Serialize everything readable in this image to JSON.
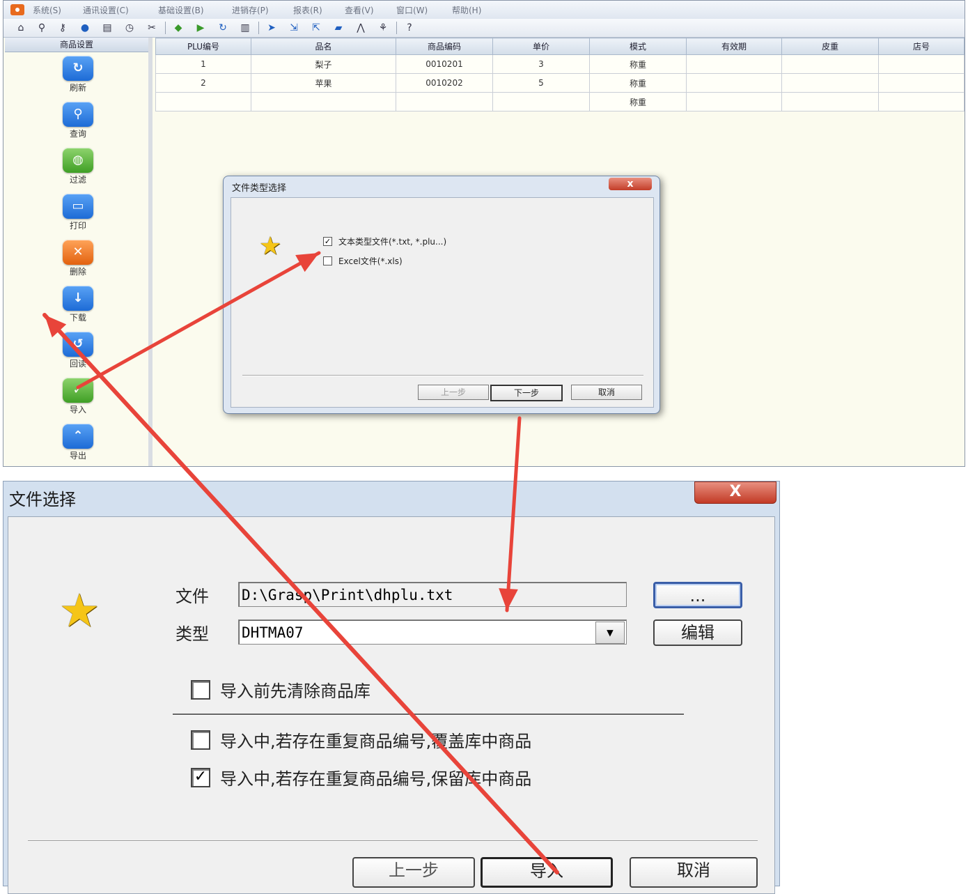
{
  "main_window": {
    "menu": [
      "系统(S)",
      "通讯设置(C)",
      "基础设置(B)",
      "进销存(P)",
      "报表(R)",
      "查看(V)",
      "窗口(W)",
      "帮助(H)"
    ],
    "toolbar_icons": [
      "home-icon",
      "pin-icon",
      "key-icon",
      "globe-icon",
      "document-icon",
      "clock-icon",
      "tools-icon",
      "diamond-icon",
      "arrow-right-icon",
      "refresh-icon",
      "book-icon",
      "send-icon",
      "export-icon",
      "import-icon",
      "folder-icon",
      "chart-icon",
      "tree-icon",
      "help-icon"
    ],
    "left_panel": {
      "header": "商品设置",
      "buttons": [
        {
          "label": "刷新",
          "icon": "refresh-icon",
          "color": "#2f7fe0"
        },
        {
          "label": "查询",
          "icon": "search-icon",
          "color": "#2f7fe0"
        },
        {
          "label": "过滤",
          "icon": "globe-icon",
          "color": "#5cb83a"
        },
        {
          "label": "打印",
          "icon": "printer-icon",
          "color": "#2f7fe0"
        },
        {
          "label": "删除",
          "icon": "delete-icon",
          "color": "#ef7b21"
        },
        {
          "label": "下载",
          "icon": "download-icon",
          "color": "#2f7fe0"
        },
        {
          "label": "回读",
          "icon": "readback-icon",
          "color": "#2f7fe0"
        },
        {
          "label": "导入",
          "icon": "import-icon",
          "color": "#5cb83a"
        },
        {
          "label": "导出",
          "icon": "export-icon",
          "color": "#2f7fe0"
        }
      ]
    },
    "grid": {
      "columns": [
        "PLU编号",
        "品名",
        "商品编码",
        "单价",
        "模式",
        "有效期",
        "皮重",
        "店号"
      ],
      "rows": [
        [
          "1",
          "梨子",
          "0010201",
          "3",
          "称重",
          "",
          "",
          ""
        ],
        [
          "2",
          "苹果",
          "0010202",
          "5",
          "称重",
          "",
          "",
          ""
        ],
        [
          "",
          "",
          "",
          "",
          "称重",
          "",
          "",
          ""
        ]
      ]
    }
  },
  "dialog_file_type": {
    "title": "文件类型选择",
    "close": "x",
    "options": [
      {
        "label": "文本类型文件(*.txt, *.plu...)",
        "checked": true
      },
      {
        "label": "Excel文件(*.xls)",
        "checked": false
      }
    ],
    "buttons": {
      "prev": "上一步",
      "next": "下一步",
      "cancel": "取消"
    }
  },
  "dialog_file_select": {
    "title": "文件选择",
    "close": "X",
    "file_label": "文件",
    "file_value": "D:\\Grasp\\Print\\dhplu.txt",
    "browse_label": "...",
    "type_label": "类型",
    "type_value": "DHTMA07",
    "edit_label": "编辑",
    "options": [
      {
        "label": "导入前先清除商品库",
        "checked": false
      },
      {
        "label": "导入中,若存在重复商品编号,覆盖库中商品",
        "checked": false
      },
      {
        "label": "导入中,若存在重复商品编号,保留库中商品",
        "checked": true
      }
    ],
    "buttons": {
      "prev": "上一步",
      "import": "导入",
      "cancel": "取消"
    }
  },
  "annotation_color": "#e8443a"
}
